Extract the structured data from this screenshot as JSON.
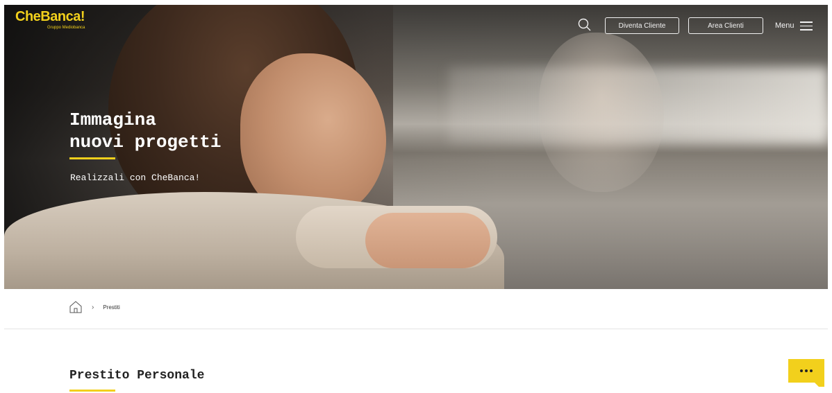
{
  "header": {
    "logo": "CheBanca!",
    "logo_subtitle": "Gruppo Mediobanca",
    "buttons": {
      "diventa_cliente": "Diventa Cliente",
      "area_clienti": "Area Clienti"
    },
    "menu_label": "Menu",
    "icons": [
      "search-icon",
      "hamburger-icon"
    ]
  },
  "hero": {
    "title_line1": "Immagina",
    "title_line2": "nuovi progetti",
    "subtitle": "Realizzali con CheBanca!"
  },
  "breadcrumb": {
    "home_icon": "home-icon",
    "separator": "›",
    "items": [
      "Prestiti"
    ]
  },
  "main": {
    "section_title": "Prestito Personale"
  },
  "chat": {
    "icon": "chat-ellipsis-icon"
  },
  "colors": {
    "accent": "#f2d01c",
    "text_dark": "#222222",
    "text_light": "#ffffff"
  }
}
